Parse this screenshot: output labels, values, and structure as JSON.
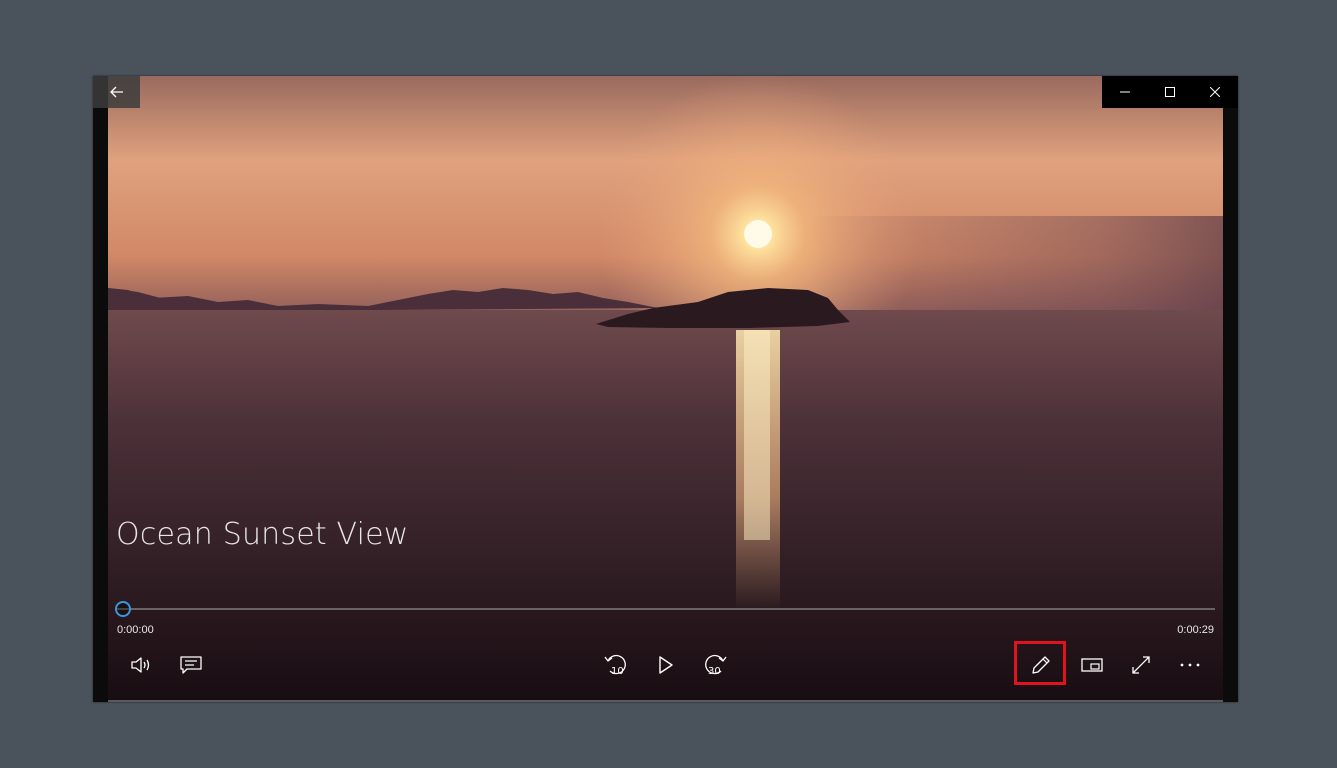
{
  "app": {
    "title": "Ocean Sunset View"
  },
  "window_controls": {
    "minimize": "minimize",
    "maximize": "maximize",
    "close": "close"
  },
  "player": {
    "current_time": "0:00:00",
    "duration": "0:00:29",
    "progress": 0.0,
    "controls": {
      "volume": "volume-icon",
      "captions": "captions-icon",
      "skip_back": "10",
      "play": "play-icon",
      "skip_forward": "30",
      "edit": "pencil-icon",
      "mini_view": "mini-view-icon",
      "fullscreen": "fullscreen-icon",
      "more": "more-icon"
    }
  },
  "colors": {
    "accent": "#3a96dd",
    "highlight": "#e0141e",
    "background": "#4a535c"
  }
}
